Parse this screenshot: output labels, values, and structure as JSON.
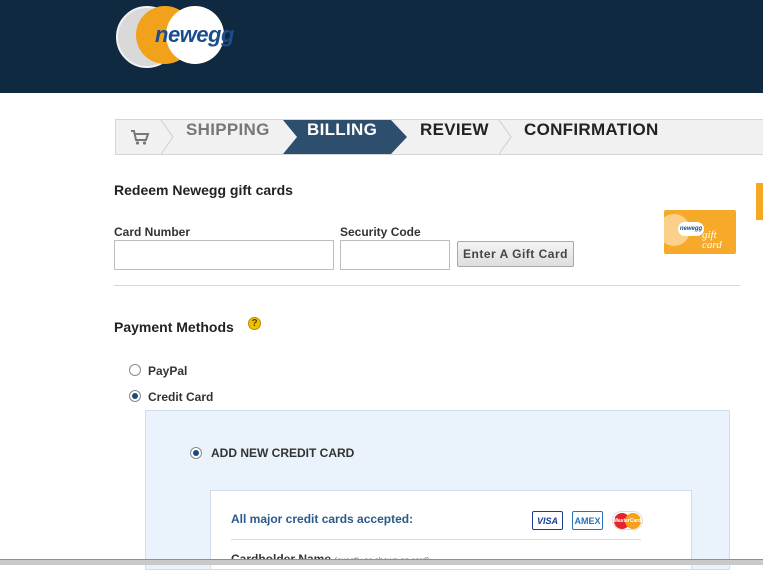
{
  "brand": {
    "logo_text": "newegg",
    "logo_color": "#1b4d8c",
    "header_bg": "#0f2940"
  },
  "steps": {
    "cart_icon": "shopping-cart-icon",
    "items": [
      "SHIPPING",
      "BILLING",
      "REVIEW",
      "CONFIRMATION"
    ],
    "active": "BILLING",
    "active_color": "#2e4e6e"
  },
  "gift_cards": {
    "title": "Redeem Newegg gift cards",
    "card_number_label": "Card Number",
    "card_number_value": "",
    "security_code_label": "Security Code",
    "security_code_value": "",
    "button_label": "Enter A Gift Card",
    "gift_card_image_text": "gift card"
  },
  "payment": {
    "title": "Payment Methods",
    "help_icon": "help-icon",
    "options": [
      {
        "label": "PayPal",
        "selected": false
      },
      {
        "label": "Credit Card",
        "selected": true
      }
    ]
  },
  "credit_card": {
    "add_new_label": "ADD NEW CREDIT CARD",
    "add_new_selected": true,
    "accepted_text": "All major credit cards accepted:",
    "card_logos": [
      "VISA",
      "AMEX",
      "MasterCard"
    ],
    "cardholder_label": "Cardholder Name",
    "cardholder_hint": "(exactly as shown on card)"
  }
}
